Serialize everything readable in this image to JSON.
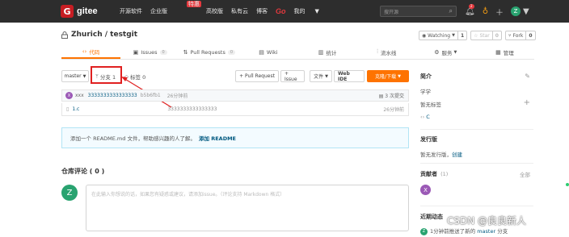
{
  "nav": {
    "logo_text": "gitee",
    "links": [
      "开源软件",
      "企业版",
      "高校版",
      "私有云",
      "博客",
      "Go",
      "我的"
    ],
    "enterprise_badge": "特惠",
    "search_placeholder": "搜开源",
    "notif_count": "2",
    "user_initial": "Z"
  },
  "repo": {
    "title": "Zhurich / testgit",
    "watching_label": "Watching",
    "watching_count": "1",
    "star_label": "Star",
    "star_count": "0",
    "fork_label": "Fork",
    "fork_count": "0"
  },
  "tabs": [
    {
      "label": "代码",
      "count": ""
    },
    {
      "label": "Issues",
      "count": "0"
    },
    {
      "label": "Pull Requests",
      "count": "0"
    },
    {
      "label": "Wiki",
      "count": ""
    },
    {
      "label": "统计",
      "count": ""
    },
    {
      "label": "流水线",
      "count": ""
    },
    {
      "label": "服务",
      "count": ""
    },
    {
      "label": "管理",
      "count": ""
    }
  ],
  "toolbar": {
    "branch": "master",
    "branches_label": "分支 1",
    "tags_label": "标签 0",
    "pull_request": "+ Pull Request",
    "issue": "+ Issue",
    "file": "文件",
    "web_ide": "Web IDE",
    "clone": "克隆/下载"
  },
  "commit": {
    "author_initial": "X",
    "author": "xxx",
    "message": "3333333333333333",
    "hash": "b5b6fb1",
    "time": "26分钟前",
    "count": "3 次提交"
  },
  "files": [
    {
      "name": "1.c",
      "message": "3333333333333333",
      "time": "26分钟前"
    }
  ],
  "readme_tip": {
    "text": "添加一个 README.md 文件，帮助感兴趣的人了解。",
    "link": "添加 README"
  },
  "comments": {
    "title": "仓库评论 ( 0 )",
    "user_initial": "Z",
    "placeholder": "在此输入你想说的话，如果您有疑惑或建议，请添加issue。（评论支持 Markdown 格式）"
  },
  "sidebar": {
    "intro_title": "简介",
    "intro_text": "学学",
    "no_tags": "暂无标签",
    "language": "C",
    "releases_title": "发行版",
    "no_releases": "暂无发行版，",
    "create_link": "创建",
    "contributors_title": "贡献者",
    "contributors_count": "(1)",
    "all_link": "全部",
    "contributor_initial": "X",
    "activity_title": "近期动态",
    "activity_text": "1分钟前推送了新的",
    "activity_branch": "master",
    "activity_suffix": "分支"
  },
  "watermark": "CSDN @良良新人"
}
